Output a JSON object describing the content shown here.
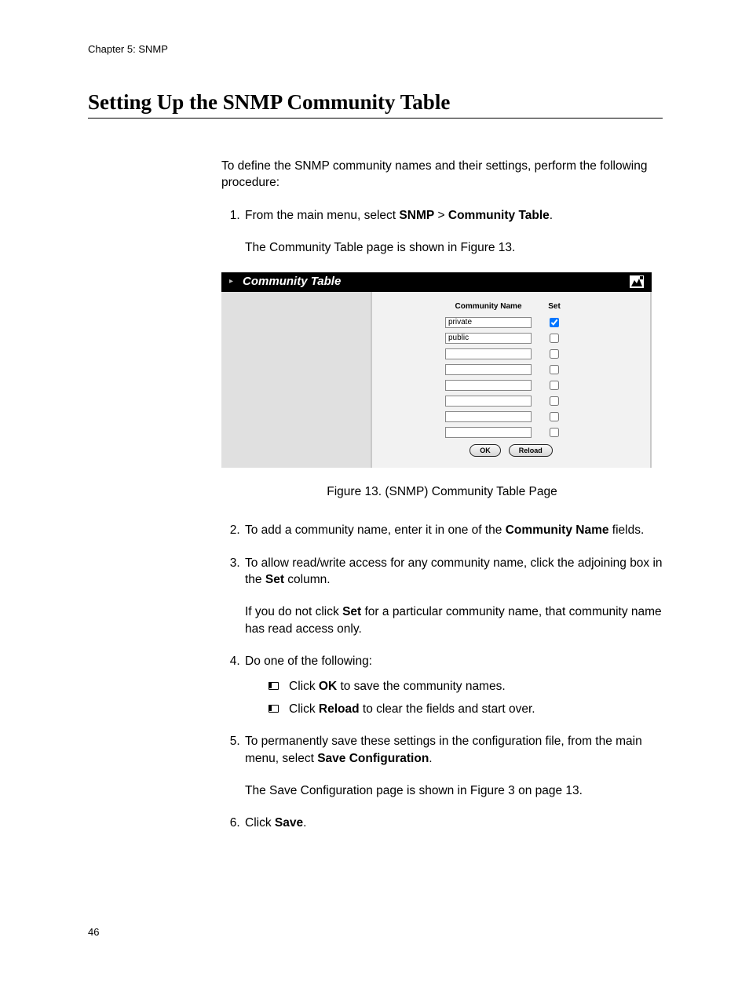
{
  "header": {
    "running": "Chapter 5: SNMP"
  },
  "title": "Setting Up the SNMP Community Table",
  "intro": "To define the SNMP community names and their settings, perform the following procedure:",
  "steps": {
    "s1_pre": "From the main menu, select ",
    "s1_b1": "SNMP",
    "s1_mid": " > ",
    "s1_b2": "Community Table",
    "s1_post": ".",
    "s1_after": "The Community Table page is shown in Figure 13.",
    "s2_pre": "To add a community name, enter it in one of the ",
    "s2_b1": "Community Name",
    "s2_post": " fields.",
    "s3_pre": "To allow read/write access for any community name, click the adjoining box in the ",
    "s3_b1": "Set",
    "s3_post": " column.",
    "s3_after_pre": "If you do not click ",
    "s3_after_b1": "Set",
    "s3_after_post": " for a particular community name, that community name has read access only.",
    "s4": "Do one of the following:",
    "s4a_pre": "Click ",
    "s4a_b1": "OK",
    "s4a_post": " to save the community names.",
    "s4b_pre": "Click ",
    "s4b_b1": "Reload",
    "s4b_post": " to clear the fields and start over.",
    "s5_pre": "To permanently save these settings in the configuration file, from the main menu, select ",
    "s5_b1": "Save Configuration",
    "s5_post": ".",
    "s5_after": "The Save Configuration page is shown in Figure 3 on page 13.",
    "s6_pre": "Click ",
    "s6_b1": "Save",
    "s6_post": "."
  },
  "figure": {
    "caption": "Figure 13. (SNMP) Community Table Page",
    "window": {
      "title": "Community Table",
      "col1": "Community Name",
      "col2": "Set",
      "rows": [
        {
          "name": "private",
          "set": true
        },
        {
          "name": "public",
          "set": false
        },
        {
          "name": "",
          "set": false
        },
        {
          "name": "",
          "set": false
        },
        {
          "name": "",
          "set": false
        },
        {
          "name": "",
          "set": false
        },
        {
          "name": "",
          "set": false
        },
        {
          "name": "",
          "set": false
        }
      ],
      "ok": "OK",
      "reload": "Reload"
    }
  },
  "page_number": "46"
}
